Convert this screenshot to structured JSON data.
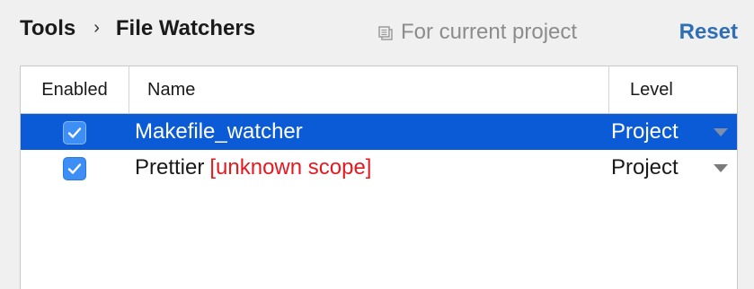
{
  "header": {
    "breadcrumb_root": "Tools",
    "breadcrumb_separator": "›",
    "breadcrumb_current": "File Watchers",
    "scope_label": "For current project",
    "reset_label": "Reset"
  },
  "table": {
    "columns": {
      "enabled": "Enabled",
      "name": "Name",
      "level": "Level"
    },
    "rows": [
      {
        "enabled": true,
        "name": "Makefile_watcher",
        "unknown_scope": "",
        "level": "Project",
        "selected": true
      },
      {
        "enabled": true,
        "name": "Prettier",
        "unknown_scope": "[unknown scope]",
        "level": "Project",
        "selected": false
      }
    ]
  },
  "colors": {
    "selection": "#0b5bd7",
    "checkbox": "#3d8ef5",
    "link": "#2f6fb5",
    "error": "#e6191f"
  },
  "icons": {
    "scope": "copy-icon",
    "checkbox": "checkmark-icon",
    "dropdown": "triangle-down-icon"
  }
}
